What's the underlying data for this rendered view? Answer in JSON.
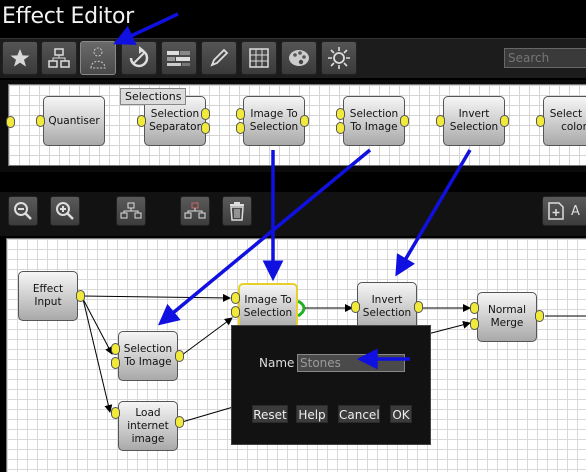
{
  "window": {
    "title": "Effect Editor"
  },
  "tabs": [
    {
      "icon": "star-icon"
    },
    {
      "icon": "node-graph-icon"
    },
    {
      "icon": "selection-person-icon",
      "active": true
    },
    {
      "icon": "rotate-icon"
    },
    {
      "icon": "color-bars-icon"
    },
    {
      "icon": "pencil-icon"
    },
    {
      "icon": "grid-icon"
    },
    {
      "icon": "palette-icon"
    },
    {
      "icon": "brightness-icon"
    }
  ],
  "search": {
    "placeholder": "Search"
  },
  "palette": {
    "tooltip": "Selections",
    "nodes": [
      "Quantiser",
      "Selection Separator",
      "Image To Selection",
      "Selection To Image",
      "Invert Selection",
      "Select by color"
    ]
  },
  "toolbar": {
    "buttons": [
      "zoom-out-icon",
      "zoom-in-icon",
      "layout-icon",
      "layout-remove-icon",
      "trash-icon"
    ],
    "add_label": "A"
  },
  "graph": {
    "nodes": [
      "Effect Input",
      "Selection To Image",
      "Load internet image",
      "Image To Selection",
      "Invert Selection",
      "Normal Merge"
    ]
  },
  "dialog": {
    "name_label": "Name",
    "name_value": "Stones",
    "buttons": [
      "Reset",
      "Help",
      "Cancel",
      "OK"
    ]
  },
  "colors": {
    "accent_arrow": "#1010e0",
    "port": "#f2ea3a",
    "selected_border": "#e8d02a",
    "connector_active": "#20b020"
  }
}
